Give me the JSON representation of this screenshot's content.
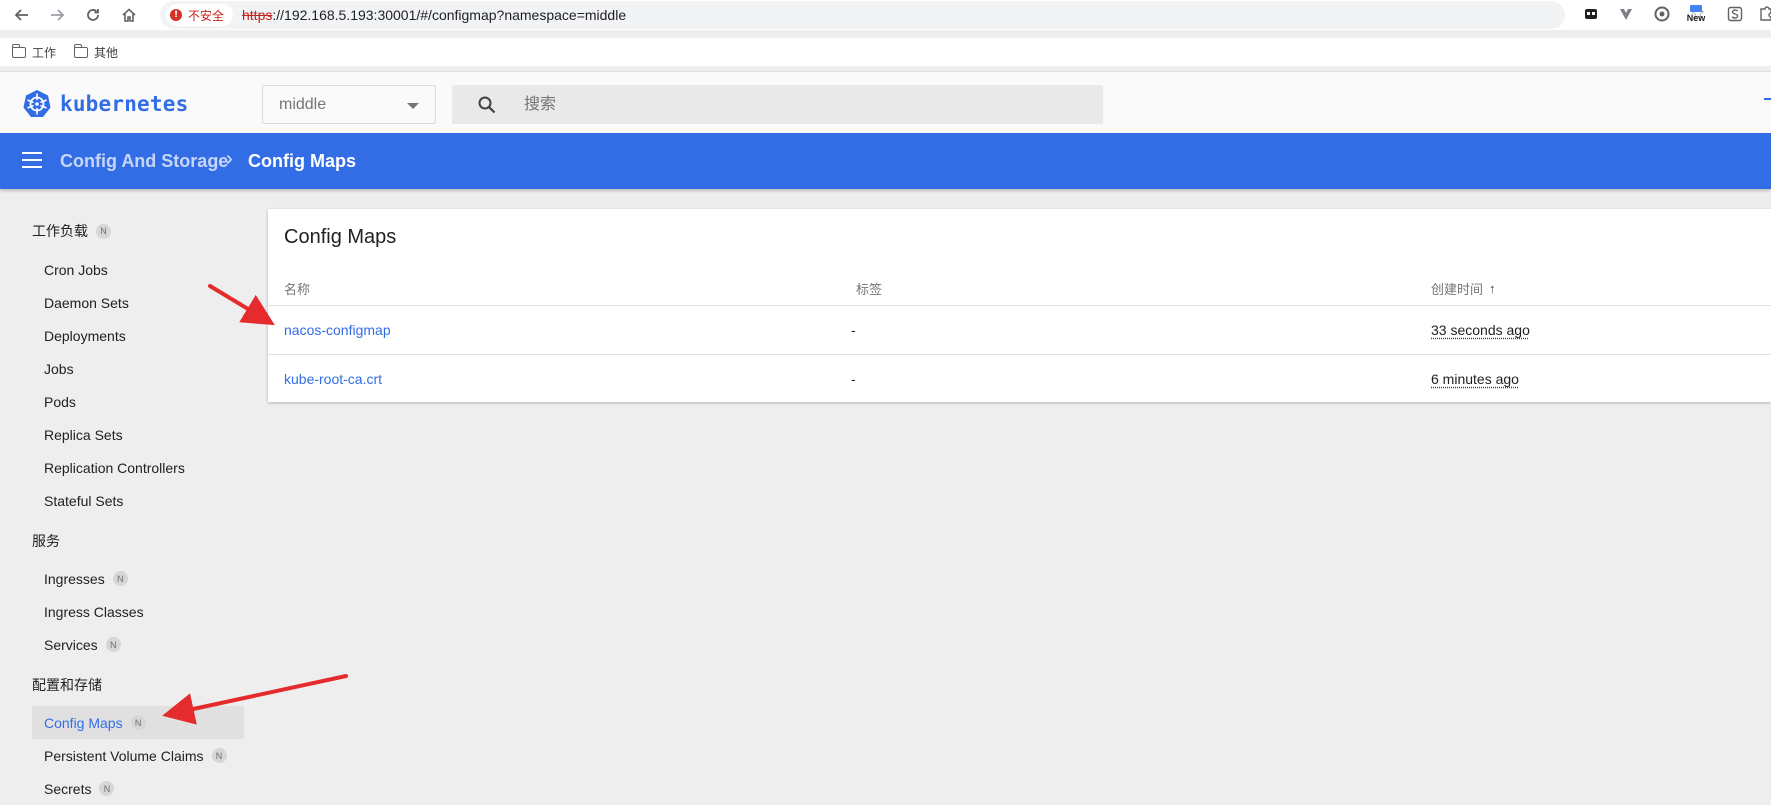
{
  "browser": {
    "security_label": "不安全",
    "url_scheme": "https",
    "url_rest": "://192.168.5.193:30001/#/configmap?namespace=middle",
    "extensions": [
      "tab-icon",
      "vue-devtools-icon",
      "record-icon",
      "new-badge-icon",
      "s-icon",
      "puzzle-icon"
    ],
    "new_label": "New"
  },
  "bookmarks": [
    {
      "label": "工作"
    },
    {
      "label": "其他"
    }
  ],
  "app": {
    "brand": "kubernetes",
    "namespace": "middle",
    "search_placeholder": "搜索",
    "accent_color": "#326de6"
  },
  "breadcrumb": {
    "parent": "Config And Storage",
    "current": "Config Maps"
  },
  "sidebar": {
    "groups": [
      {
        "label": "工作负载",
        "badge": "N",
        "items": [
          {
            "label": "Cron Jobs"
          },
          {
            "label": "Daemon Sets"
          },
          {
            "label": "Deployments"
          },
          {
            "label": "Jobs"
          },
          {
            "label": "Pods"
          },
          {
            "label": "Replica Sets"
          },
          {
            "label": "Replication Controllers"
          },
          {
            "label": "Stateful Sets"
          }
        ]
      },
      {
        "label": "服务",
        "items": [
          {
            "label": "Ingresses",
            "badge": "N"
          },
          {
            "label": "Ingress Classes"
          },
          {
            "label": "Services",
            "badge": "N"
          }
        ]
      },
      {
        "label": "配置和存储",
        "items": [
          {
            "label": "Config Maps",
            "badge": "N",
            "active": true
          },
          {
            "label": "Persistent Volume Claims",
            "badge": "N"
          },
          {
            "label": "Secrets",
            "badge": "N"
          }
        ]
      }
    ]
  },
  "table": {
    "title": "Config Maps",
    "columns": [
      "名称",
      "标签",
      "创建时间"
    ],
    "sort_indicator": "↑",
    "rows": [
      {
        "name": "nacos-configmap",
        "labels": "-",
        "created": "33 seconds ago"
      },
      {
        "name": "kube-root-ca.crt",
        "labels": "-",
        "created": "6 minutes ago"
      }
    ]
  }
}
